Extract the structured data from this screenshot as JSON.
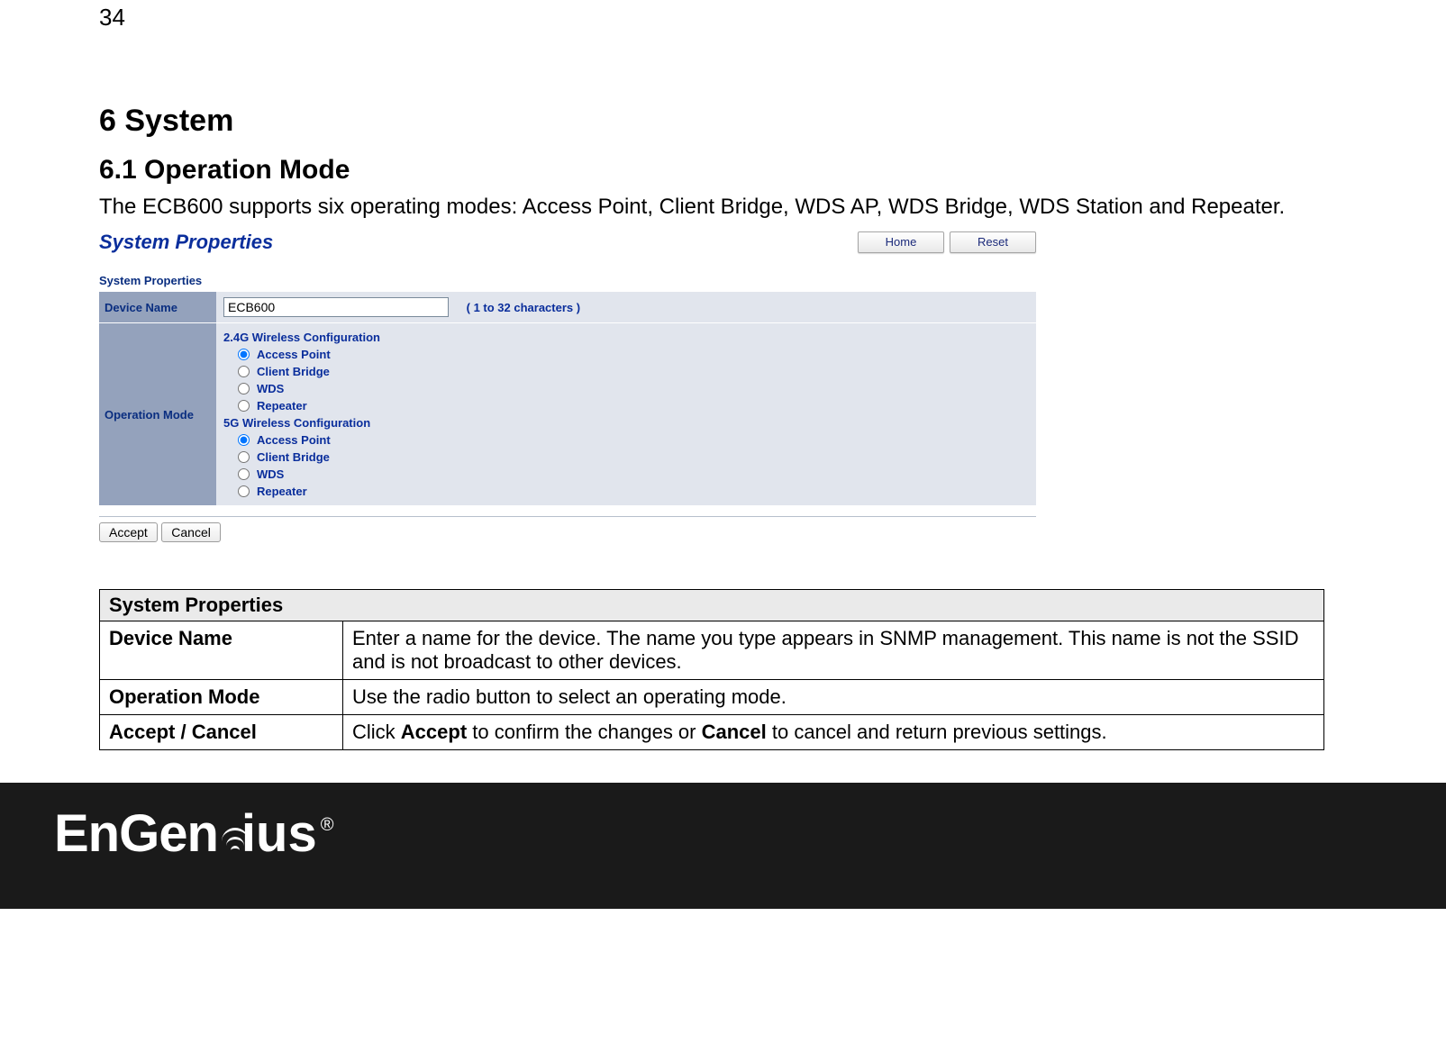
{
  "pageNumber": "34",
  "heading": "6  System",
  "subheading": "6.1   Operation Mode",
  "intro": "The ECB600 supports six operating modes: Access Point, Client Bridge, WDS AP, WDS Bridge, WDS Station and Repeater.",
  "panel": {
    "title": "System Properties",
    "navButtons": {
      "home": "Home",
      "reset": "Reset"
    },
    "subhead": "System Properties",
    "labels": {
      "deviceName": "Device Name",
      "operationMode": "Operation Mode"
    },
    "deviceName": {
      "value": "ECB600",
      "note": "( 1 to 32 characters )"
    },
    "cfg24": {
      "label": "2.4G Wireless Configuration",
      "options": [
        {
          "label": "Access Point",
          "checked": true
        },
        {
          "label": "Client Bridge",
          "checked": false
        },
        {
          "label": "WDS",
          "checked": false
        },
        {
          "label": "Repeater",
          "checked": false
        }
      ]
    },
    "cfg5": {
      "label": "5G Wireless Configuration",
      "options": [
        {
          "label": "Access Point",
          "checked": true
        },
        {
          "label": "Client Bridge",
          "checked": false
        },
        {
          "label": "WDS",
          "checked": false
        },
        {
          "label": "Repeater",
          "checked": false
        }
      ]
    },
    "actions": {
      "accept": "Accept",
      "cancel": "Cancel"
    }
  },
  "descTable": {
    "header": "System Properties",
    "rows": [
      {
        "key": "Device Name",
        "val_pre": "Enter a name for the device. The name you type appears in SNMP management. This name is not the SSID and is not broadcast to other devices."
      },
      {
        "key": "Operation Mode",
        "val_pre": "Use the radio button to select an operating mode."
      },
      {
        "key": "Accept / Cancel",
        "val_pre": "Click ",
        "b1": "Accept",
        "mid": " to confirm the changes or ",
        "b2": "Cancel",
        "val_post": " to cancel and return previous settings."
      }
    ]
  },
  "footer": {
    "brand": "EnGenius",
    "reg": "®"
  }
}
